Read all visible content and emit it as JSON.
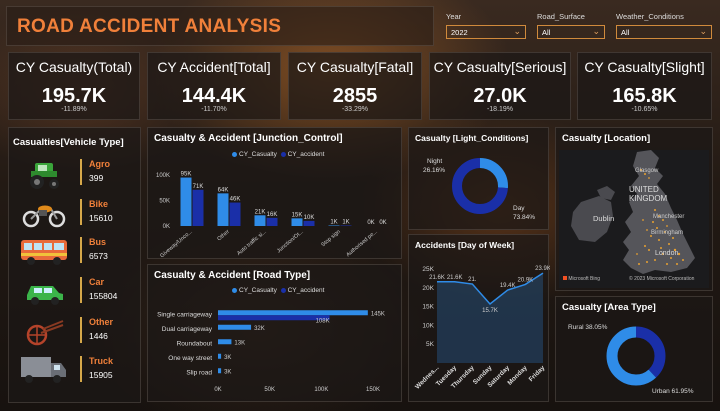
{
  "header": {
    "title": "ROAD ACCIDENT ANALYSIS"
  },
  "filters": [
    {
      "label": "Year",
      "value": "2022"
    },
    {
      "label": "Road_Surface",
      "value": "All"
    },
    {
      "label": "Weather_Conditions",
      "value": "All"
    }
  ],
  "kpis": [
    {
      "label": "CY Casualty(Total)",
      "value": "195.7K",
      "change": "-11.89%"
    },
    {
      "label": "CY Accident[Total]",
      "value": "144.4K",
      "change": "-11.70%"
    },
    {
      "label": "CY Casualty[Fatal]",
      "value": "2855",
      "change": "-33.29%"
    },
    {
      "label": "CY Casualty[Serious]",
      "value": "27.0K",
      "change": "-18.19%"
    },
    {
      "label": "CY Casualty[Slight]",
      "value": "165.8K",
      "change": "-10.65%"
    }
  ],
  "vehicle_type": {
    "title": "Casualties[Vehicle Type]",
    "items": [
      {
        "name": "Agro",
        "value": "399",
        "icon": "tractor-icon"
      },
      {
        "name": "Bike",
        "value": "15610",
        "icon": "motorbike-icon"
      },
      {
        "name": "Bus",
        "value": "6573",
        "icon": "bus-icon"
      },
      {
        "name": "Car",
        "value": "155804",
        "icon": "car-icon"
      },
      {
        "name": "Other",
        "value": "1446",
        "icon": "cart-icon"
      },
      {
        "name": "Truck",
        "value": "15905",
        "icon": "truck-icon"
      }
    ]
  },
  "location": {
    "title": "Casualty [Location]",
    "map_labels": [
      "Glasgow",
      "UNITED KINGDOM",
      "Dublin",
      "Manchester",
      "Birmingham",
      "London"
    ],
    "attribution": "© 2023 Microsoft Corporation",
    "logo": "Microsoft Bing"
  },
  "colors": {
    "cy": "#2f8ce8",
    "py": "#1a2fa8",
    "accent": "#f0803a"
  },
  "chart_data": [
    {
      "type": "bar",
      "title": "Casualty & Accident [Junction_Control]",
      "categories": [
        "Give way or uncontrolled",
        "Other",
        "Auto traffic signal",
        "Junction/Stop",
        "Stop sign",
        "Authorised person"
      ],
      "tick_labels": [
        "Giveway/Unco...",
        "Other",
        "Auto traffic si...",
        "Junction/Ot...",
        "Stop sign",
        "Authorised pe..."
      ],
      "series": [
        {
          "name": "CY_Casualty",
          "values": [
            95,
            64,
            21,
            15,
            1,
            0
          ],
          "labels": [
            "95K",
            "64K",
            "21K",
            "15K",
            "1K",
            "0K"
          ]
        },
        {
          "name": "CY_accident",
          "values": [
            71,
            46,
            16,
            10,
            1,
            0
          ],
          "labels": [
            "71K",
            "46K",
            "16K",
            "10K",
            "1K",
            "0K"
          ]
        }
      ],
      "yticks": [
        "0K",
        "50K",
        "100K"
      ],
      "ylim": [
        0,
        100
      ]
    },
    {
      "type": "bar",
      "orientation": "horizontal",
      "title": "Casualty & Accident [Road Type]",
      "categories": [
        "Single carriageway",
        "Dual carriageway",
        "Roundabout",
        "One way street",
        "Slip road"
      ],
      "series": [
        {
          "name": "CY_Casualty",
          "values": [
            145,
            32,
            13,
            3,
            3
          ],
          "labels": [
            "145K",
            "32K",
            "13K",
            "3K",
            "3K"
          ]
        },
        {
          "name": "CY_accident",
          "values": [
            108,
            0,
            0,
            0,
            0
          ],
          "labels": [
            "108K",
            "",
            "",
            "",
            ""
          ]
        }
      ],
      "xticks": [
        "0K",
        "50K",
        "100K",
        "150K"
      ],
      "xlim": [
        0,
        150
      ]
    },
    {
      "type": "pie",
      "title": "Casualty [Light_Conditions]",
      "slices": [
        {
          "name": "Night",
          "value": 26.16,
          "label": "26.16%"
        },
        {
          "name": "Day",
          "value": 73.84,
          "label": "73.84%"
        }
      ]
    },
    {
      "type": "area",
      "title": "Accidents [Day of Week]",
      "categories": [
        "Wednes...",
        "Tuesday",
        "Thursday",
        "Sunday",
        "Saturday",
        "Monday",
        "Friday"
      ],
      "values": [
        21.6,
        21.6,
        21.0,
        15.7,
        19.4,
        20.9,
        23.9
      ],
      "labels": [
        "21.6K",
        "21.6K",
        "21.",
        "15.7K",
        "19.4K",
        "20.9K",
        "23.9K"
      ],
      "yticks": [
        "5K",
        "10K",
        "15K",
        "20K",
        "25K"
      ],
      "ylim": [
        0,
        25
      ]
    },
    {
      "type": "pie",
      "title": "Casualty [Area Type]",
      "slices": [
        {
          "name": "Rural",
          "value": 38.05,
          "label": "38.05%"
        },
        {
          "name": "Urban",
          "value": 61.95,
          "label": "61.95%"
        }
      ]
    }
  ]
}
